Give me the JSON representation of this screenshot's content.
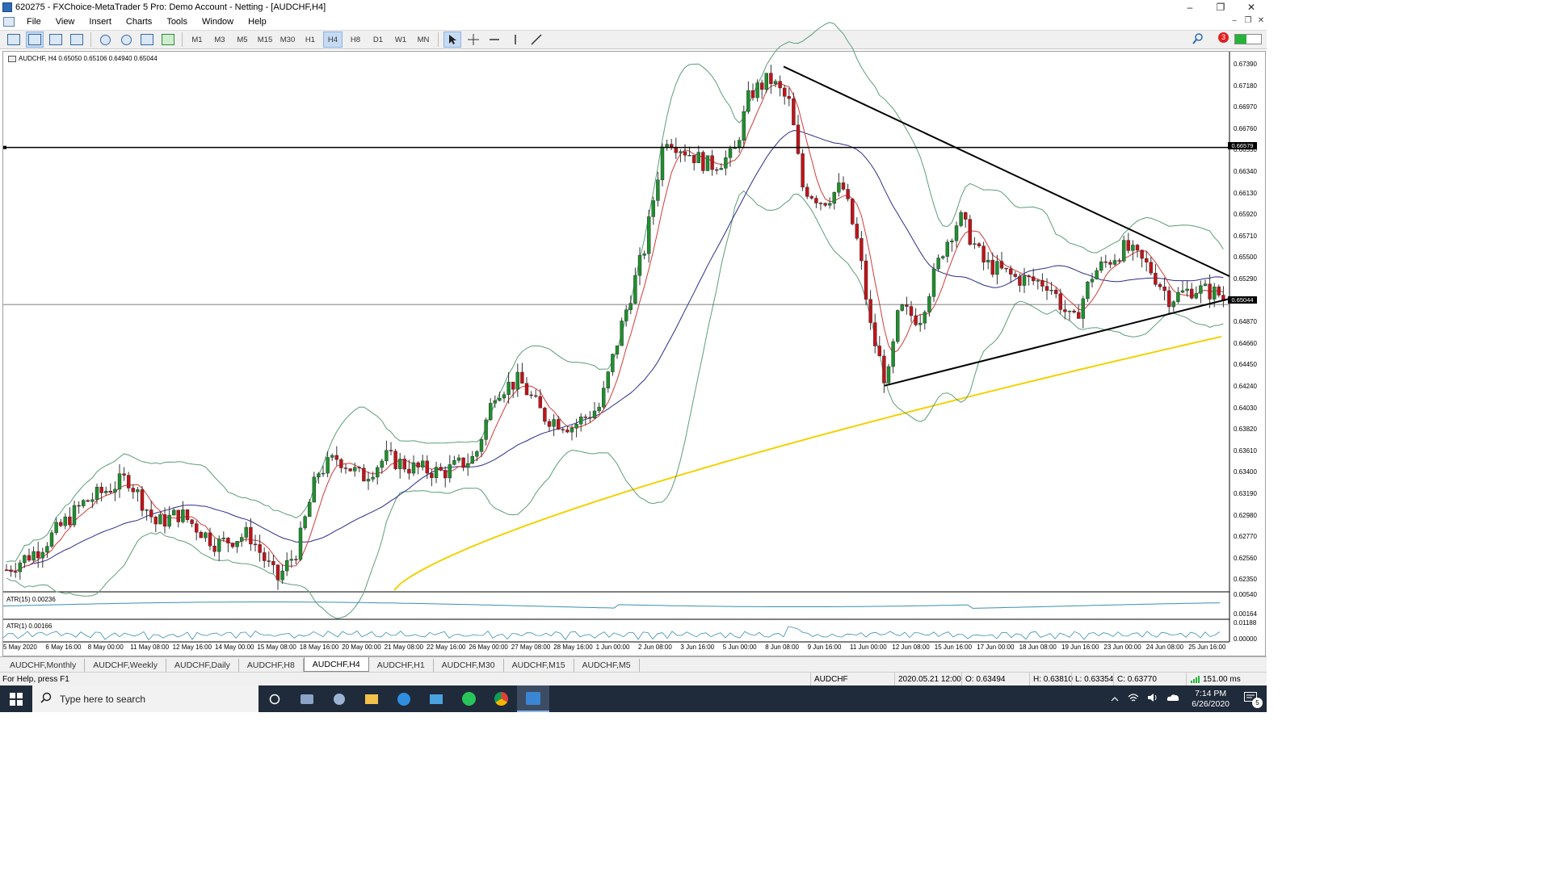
{
  "window": {
    "title": "620275 - FXChoice-MetaTrader 5 Pro: Demo Account - Netting - [AUDCHF,H4]",
    "controls": [
      "–",
      "❐",
      "✕"
    ],
    "mdi_controls": [
      "–",
      "❐",
      "✕"
    ]
  },
  "menu": [
    "File",
    "View",
    "Insert",
    "Charts",
    "Tools",
    "Window",
    "Help"
  ],
  "toolbar": {
    "timeframes": [
      "M1",
      "M3",
      "M5",
      "M15",
      "M30",
      "H1",
      "H4",
      "H8",
      "D1",
      "W1",
      "MN"
    ],
    "active_timeframe": "H4",
    "notification_count": "3"
  },
  "chart": {
    "info": "AUDCHF, H4  0.65050 0.65106 0.64940 0.65044",
    "atr15_label": "ATR(15) 0.00236",
    "atr1_label": "ATR(1) 0.00166",
    "price_labels": [
      "0.67390",
      "0.67180",
      "0.66970",
      "0.66760",
      "0.66550",
      "0.66340",
      "0.66130",
      "0.65920",
      "0.65710",
      "0.65500",
      "0.65290",
      "0.65080",
      "0.64870",
      "0.64660",
      "0.64450",
      "0.64240",
      "0.64030",
      "0.63820",
      "0.63610",
      "0.63400",
      "0.63190",
      "0.62980",
      "0.62770",
      "0.62560",
      "0.62350"
    ],
    "horizontal_line_price": "0.66579",
    "bid_price": "0.65044",
    "atr15_scale": [
      "0.00540",
      "0.00164"
    ],
    "atr1_scale": [
      "0.01188",
      "0.00000"
    ],
    "time_labels": [
      "5 May 2020",
      "6 May 16:00",
      "8 May 00:00",
      "11 May 08:00",
      "12 May 16:00",
      "14 May 00:00",
      "15 May 08:00",
      "18 May 16:00",
      "20 May 00:00",
      "21 May 08:00",
      "22 May 16:00",
      "26 May 00:00",
      "27 May 08:00",
      "28 May 16:00",
      "1 Jun 00:00",
      "2 Jun 08:00",
      "3 Jun 16:00",
      "5 Jun 00:00",
      "8 Jun 08:00",
      "9 Jun 16:00",
      "11 Jun 00:00",
      "12 Jun 08:00",
      "15 Jun 16:00",
      "17 Jun 00:00",
      "18 Jun 08:00",
      "19 Jun 16:00",
      "23 Jun 00:00",
      "24 Jun 08:00",
      "25 Jun 16:00"
    ],
    "colors": {
      "bull": "#1f8f2f",
      "bear": "#c0141a",
      "ma_fast": "#d23a3a",
      "ma_mid": "#2c2c8c",
      "ma_slow": "#f2d200",
      "bands": "#5c9e78",
      "trendline": "#000000"
    }
  },
  "tabs": [
    "AUDCHF,Monthly",
    "AUDCHF,Weekly",
    "AUDCHF,Daily",
    "AUDCHF,H8",
    "AUDCHF,H4",
    "AUDCHF,H1",
    "AUDCHF,M30",
    "AUDCHF,M15",
    "AUDCHF,M5"
  ],
  "active_tab": "AUDCHF,H4",
  "status": {
    "help": "For Help, press F1",
    "symbol": "AUDCHF",
    "datetime": "2020.05.21 12:00",
    "open": "O: 0.63494",
    "high": "H: 0.63810",
    "low": "L: 0.63354",
    "close": "C: 0.63770",
    "ping": "151.00 ms"
  },
  "taskbar": {
    "search_placeholder": "Type here to search",
    "time": "7:14 PM",
    "date": "6/26/2020",
    "notifications": "5"
  }
}
